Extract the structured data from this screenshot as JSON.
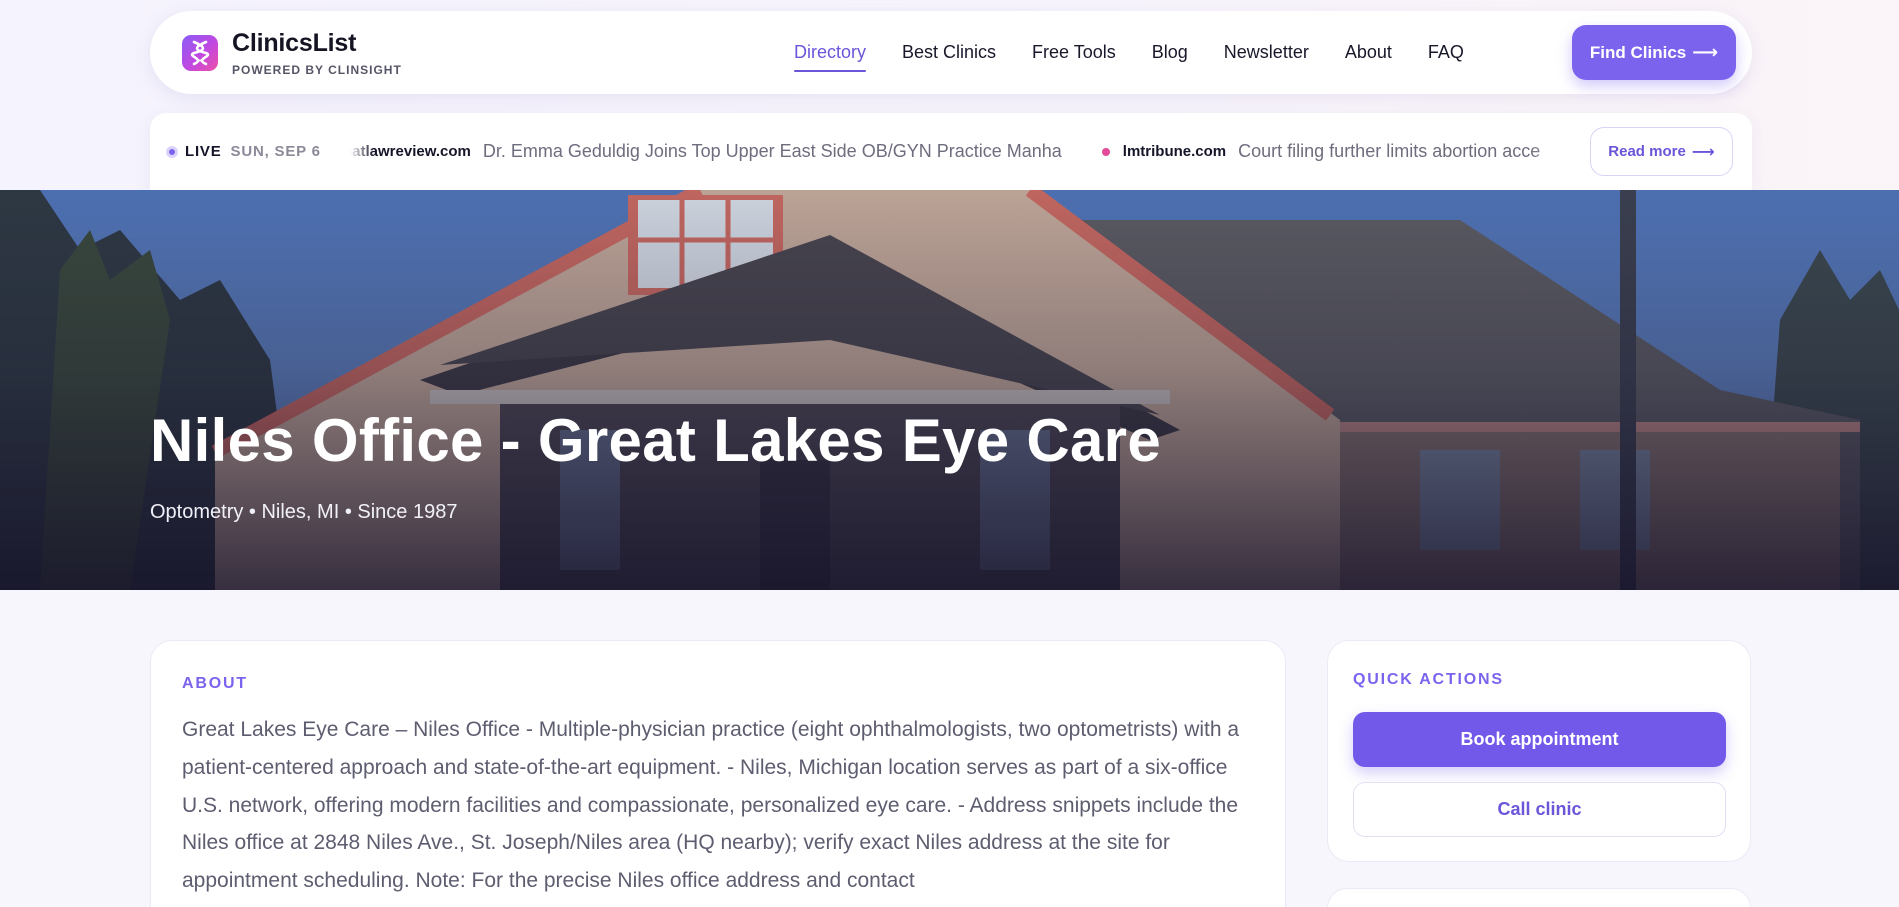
{
  "header": {
    "brand_name": "ClinicsList",
    "brand_sub": "POWERED BY CLINSIGHT",
    "logo_icon": "dna-icon",
    "nav": [
      {
        "label": "Directory",
        "active": true
      },
      {
        "label": "Best Clinics",
        "active": false
      },
      {
        "label": "Free Tools",
        "active": false
      },
      {
        "label": "Blog",
        "active": false
      },
      {
        "label": "Newsletter",
        "active": false
      },
      {
        "label": "About",
        "active": false
      },
      {
        "label": "FAQ",
        "active": false
      }
    ],
    "cta_label": "Find Clinics",
    "cta_icon": "arrow-right-icon"
  },
  "ticker": {
    "live_label": "LIVE",
    "date": "SUN, SEP 6",
    "items": [
      {
        "source": "natlawreview.com",
        "headline": "Dr. Emma Geduldig Joins Top Upper East Side OB/GYN Practice Manha"
      },
      {
        "source": "lmtribune.com",
        "headline": "Court filing further limits abortion acce"
      }
    ],
    "read_more_label": "Read more"
  },
  "hero": {
    "title": "Niles Office - Great Lakes Eye Care",
    "subtitle": "Optometry • Niles, MI • Since 1987"
  },
  "about": {
    "label": "ABOUT",
    "text": "Great Lakes Eye Care – Niles Office - Multiple-physician practice (eight ophthalmologists, two optometrists) with a patient-centered approach and state-of-the-art equipment. - Niles, Michigan location serves as part of a six-office U.S. network, offering modern facilities and compassionate, personalized eye care. - Address snippets include the Niles office at 2848 Niles Ave., St. Joseph/Niles area (HQ nearby); verify exact Niles address at the site for appointment scheduling. Note: For the precise Niles office address and contact"
  },
  "quick_actions": {
    "label": "QUICK ACTIONS",
    "book_label": "Book appointment",
    "call_label": "Call clinic"
  },
  "colors": {
    "accent": "#7c63ee",
    "accent_dark": "#6b55d9",
    "live_bullet": "#e54a9a",
    "text_dark": "#15152a",
    "text_muted": "#5d5d70"
  }
}
